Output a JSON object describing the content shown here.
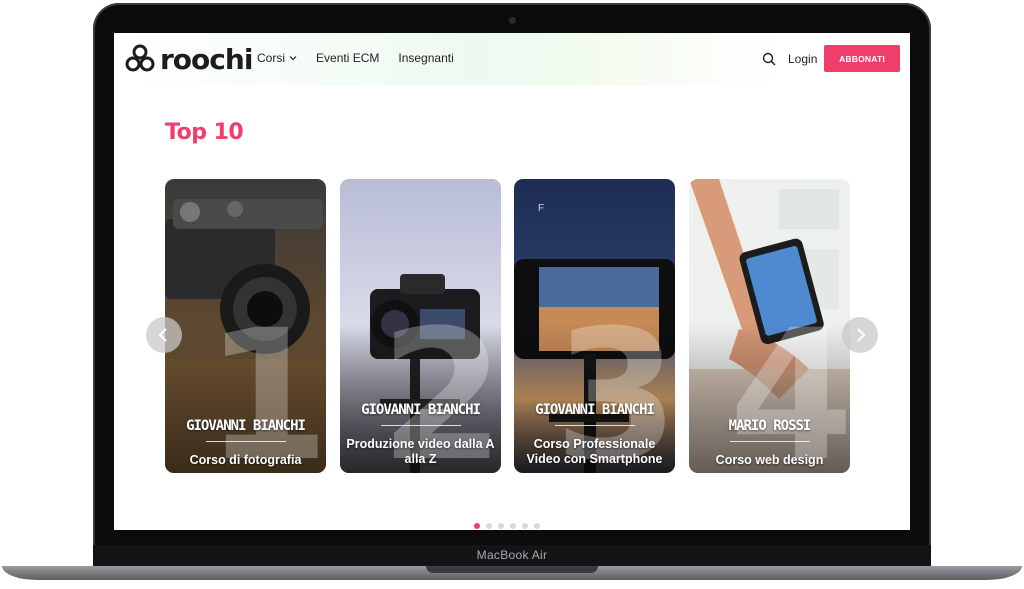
{
  "device": {
    "label": "MacBook Air"
  },
  "header": {
    "logo_text": "roochi",
    "nav": [
      {
        "label": "Corsi",
        "has_dropdown": true
      },
      {
        "label": "Eventi ECM",
        "has_dropdown": false
      },
      {
        "label": "Insegnanti",
        "has_dropdown": false
      }
    ],
    "search_icon": "search-icon",
    "login_label": "Login",
    "cta_label": "ABBONATI"
  },
  "section": {
    "title": "Top 10"
  },
  "cards": [
    {
      "rank": "1",
      "author": "GIOVANNI BIANCHI",
      "course": "Corso di fotografia",
      "badge": ""
    },
    {
      "rank": "2",
      "author": "GIOVANNI BIANCHI",
      "course": "Produzione video dalla A alla Z",
      "badge": ""
    },
    {
      "rank": "3",
      "author": "GIOVANNI BIANCHI",
      "course": "Corso Professionale Video con Smartphone",
      "badge": "F"
    },
    {
      "rank": "4",
      "author": "MARIO ROSSI",
      "course": "Corso web design",
      "badge": ""
    }
  ],
  "carousel": {
    "page_count": 6,
    "active_page": 1
  },
  "colors": {
    "accent": "#f03e6b",
    "text": "#222222"
  }
}
